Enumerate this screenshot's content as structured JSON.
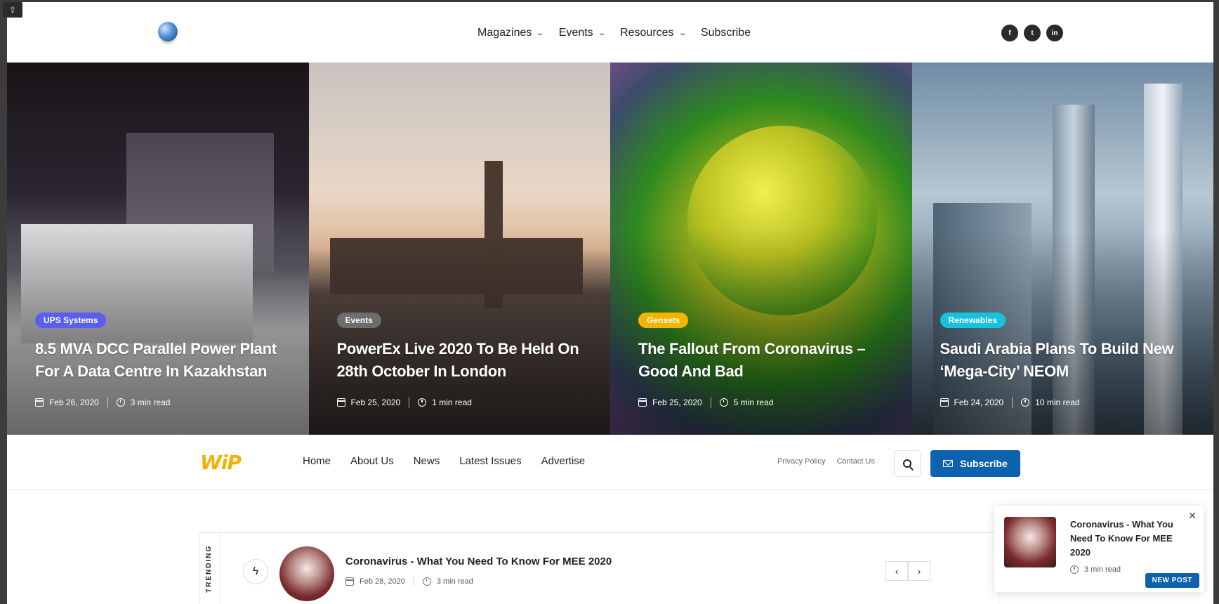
{
  "topnav": {
    "items": [
      {
        "label": "Magazines"
      },
      {
        "label": "Events"
      },
      {
        "label": "Resources"
      },
      {
        "label": "Subscribe"
      }
    ]
  },
  "socials": [
    "facebook-icon",
    "twitter-icon",
    "linkedin-icon"
  ],
  "hero": [
    {
      "tag": "UPS Systems",
      "tag_color": "#5b5ff0",
      "title": "8.5 MVA DCC Parallel Power Plant For A Data Centre In Kazakhstan",
      "date": "Feb 26, 2020",
      "read": "3 min read"
    },
    {
      "tag": "Events",
      "tag_color": "#6d6d6d",
      "title": "PowerEx Live 2020 To Be Held On 28th October In London",
      "date": "Feb 25, 2020",
      "read": "1 min read"
    },
    {
      "tag": "Gensets",
      "tag_color": "#f5b400",
      "title": "The Fallout From Coronavirus – Good And Bad",
      "date": "Feb 25, 2020",
      "read": "5 min read"
    },
    {
      "tag": "Renewables",
      "tag_color": "#17c1e0",
      "title": "Saudi Arabia Plans To Build New ‘Mega-City’ NEOM",
      "date": "Feb 24, 2020",
      "read": "10 min read"
    }
  ],
  "subbar": {
    "logo": "WiP",
    "nav": [
      "Home",
      "About Us",
      "News",
      "Latest Issues",
      "Advertise"
    ],
    "links": [
      "Privacy Policy",
      "Contact Us"
    ],
    "subscribe_label": "Subscribe"
  },
  "trending": {
    "label": "TRENDING",
    "title": "Coronavirus - What You Need To Know For MEE 2020",
    "date": "Feb 28, 2020",
    "read": "3 min read",
    "prev": "‹",
    "next": "›"
  },
  "popup": {
    "title": "Coronavirus - What You Need To Know For MEE 2020",
    "read": "3 min read",
    "badge": "NEW POST",
    "close": "✕"
  }
}
